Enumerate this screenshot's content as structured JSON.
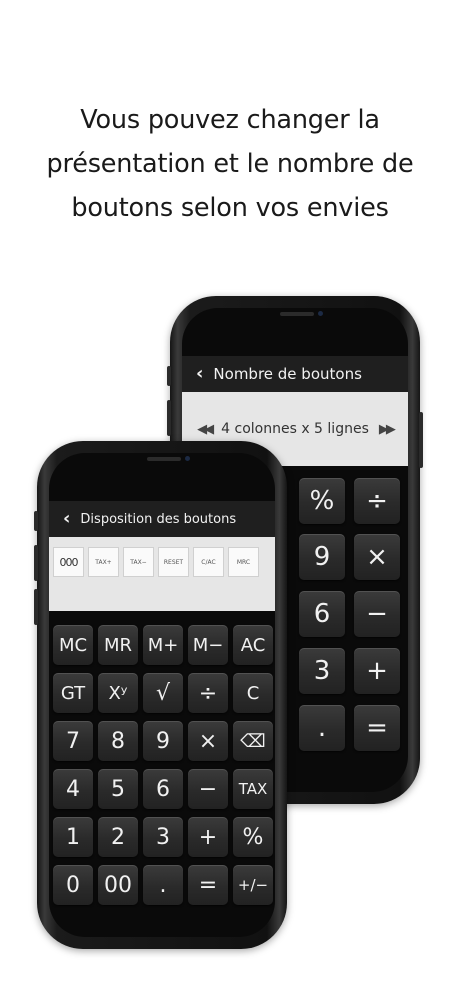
{
  "headline": {
    "line1": "Vous pouvez changer la",
    "line2": "présentation et le nombre de",
    "line3": "boutons selon vos envies"
  },
  "back_phone": {
    "nav_title": "Nombre de boutons",
    "layout_option": "4 colonnes x 5 lignes",
    "keys": [
      "%",
      "÷",
      "9",
      "×",
      "6",
      "−",
      "3",
      "+",
      ".",
      "="
    ]
  },
  "front_phone": {
    "nav_title": "Disposition des boutons",
    "option_keys": [
      "000",
      "TAX+",
      "TAX−",
      "RESET",
      "C/AC",
      "MRC"
    ],
    "keys": [
      "MC",
      "MR",
      "M+",
      "M−",
      "AC",
      "GT",
      "Xʸ",
      "√",
      "÷",
      "C",
      "7",
      "8",
      "9",
      "×",
      "⌫",
      "4",
      "5",
      "6",
      "−",
      "TAX",
      "1",
      "2",
      "3",
      "+",
      "%",
      "0",
      "00",
      ".",
      "=",
      "+/−"
    ]
  },
  "icons": {
    "back": "chevron-left-icon",
    "prev": "double-left-arrow-icon",
    "next": "double-right-arrow-icon",
    "backspace": "backspace-icon"
  }
}
